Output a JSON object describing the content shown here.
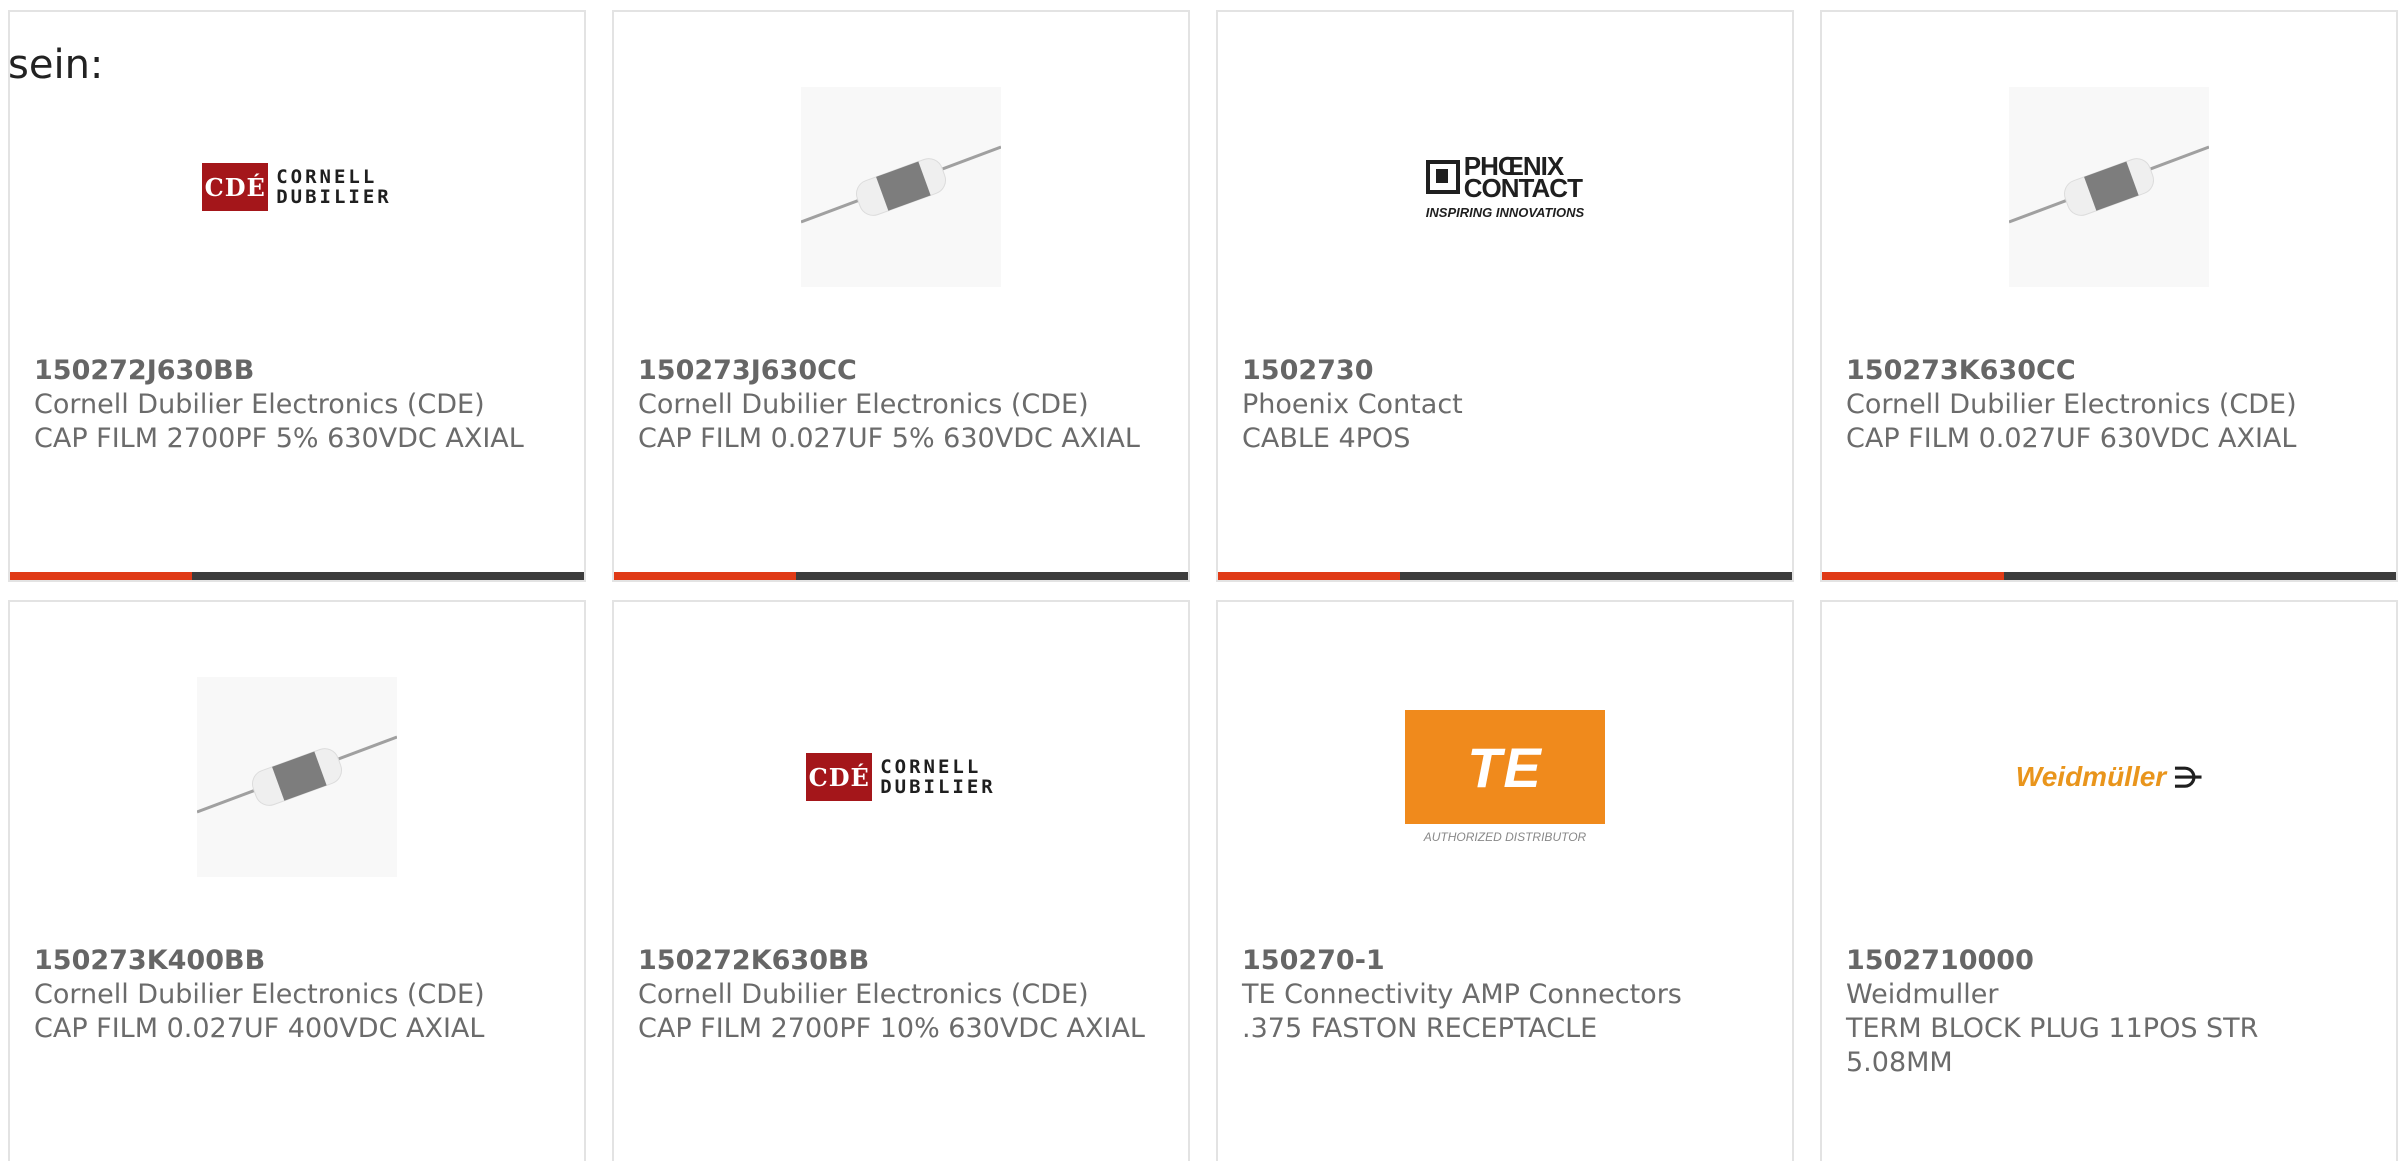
{
  "intro_text": "sein:",
  "products": [
    {
      "part_number": "150272J630BB",
      "manufacturer": "Cornell Dubilier Electronics (CDE)",
      "description": "CAP FILM 2700PF 5% 630VDC AXIAL",
      "image_type": "logo-cornell-dubilier",
      "logo_text": {
        "mark": "CDÉ",
        "line1": "CORNELL",
        "line2": "DUBILIER"
      }
    },
    {
      "part_number": "150273J630CC",
      "manufacturer": "Cornell Dubilier Electronics (CDE)",
      "description": "CAP FILM 0.027UF 5% 630VDC AXIAL",
      "image_type": "axial-capacitor-photo"
    },
    {
      "part_number": "1502730",
      "manufacturer": "Phoenix Contact",
      "description": "CABLE 4POS",
      "image_type": "logo-phoenix-contact",
      "logo_text": {
        "line1": "PHŒNIX",
        "line2": "CONTACT",
        "tagline": "INSPIRING INNOVATIONS"
      }
    },
    {
      "part_number": "150273K630CC",
      "manufacturer": "Cornell Dubilier Electronics (CDE)",
      "description": "CAP FILM 0.027UF 630VDC AXIAL",
      "image_type": "axial-capacitor-photo"
    },
    {
      "part_number": "150273K400BB",
      "manufacturer": "Cornell Dubilier Electronics (CDE)",
      "description": "CAP FILM 0.027UF 400VDC AXIAL",
      "image_type": "axial-capacitor-photo"
    },
    {
      "part_number": "150272K630BB",
      "manufacturer": "Cornell Dubilier Electronics (CDE)",
      "description": "CAP FILM 2700PF 10% 630VDC AXIAL",
      "image_type": "logo-cornell-dubilier",
      "logo_text": {
        "mark": "CDÉ",
        "line1": "CORNELL",
        "line2": "DUBILIER"
      }
    },
    {
      "part_number": "150270-1",
      "manufacturer": "TE Connectivity AMP Connectors",
      "description": ".375 FASTON RECEPTACLE",
      "image_type": "logo-te-connectivity",
      "logo_text": {
        "mark": "TE",
        "tagline": "AUTHORIZED DISTRIBUTOR"
      }
    },
    {
      "part_number": "1502710000",
      "manufacturer": "Weidmuller",
      "description": "TERM BLOCK PLUG 11POS STR 5.08MM",
      "image_type": "logo-weidmuller",
      "logo_text": {
        "word": "Weidmüller"
      }
    }
  ],
  "colors": {
    "accent_red": "#e03a16",
    "strip_dark": "#3c3c3c",
    "border": "#e3e3e3",
    "text": "#6b6b6b"
  }
}
